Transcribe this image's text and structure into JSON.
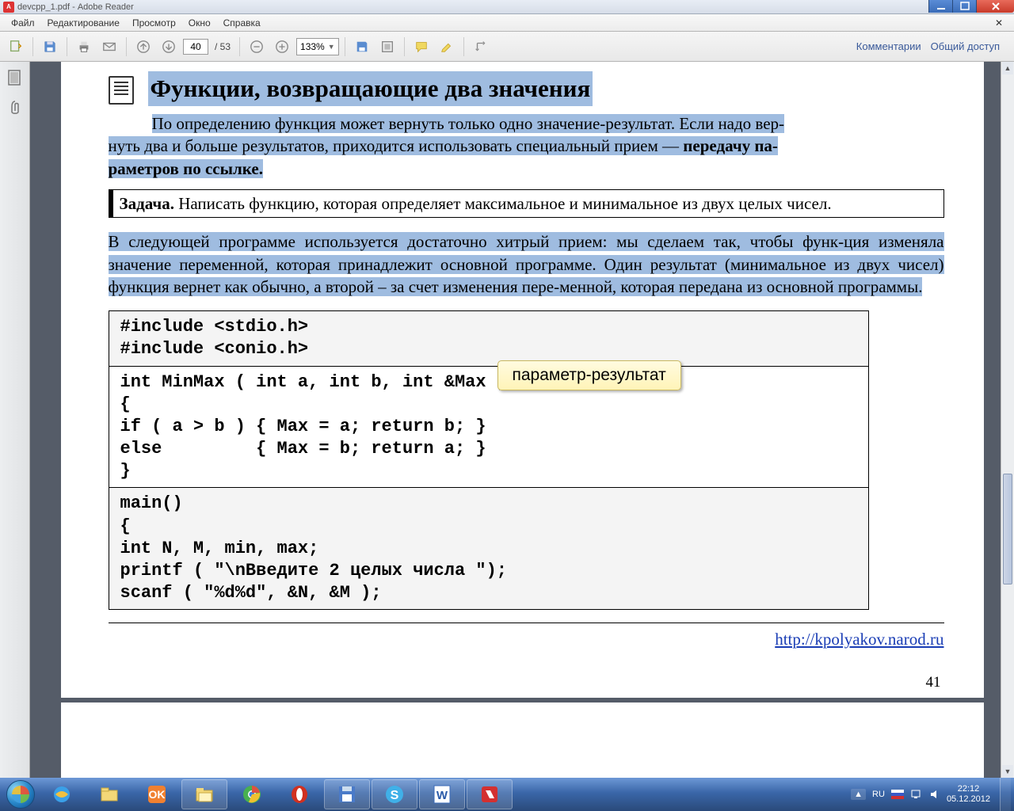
{
  "titlebar": {
    "filename": "devcpp_1.pdf",
    "app": "Adobe Reader"
  },
  "menu": {
    "file": "Файл",
    "edit": "Редактирование",
    "view": "Просмотр",
    "window": "Окно",
    "help": "Справка"
  },
  "toolbar": {
    "page_current": "40",
    "page_total": "/ 53",
    "zoom": "133%",
    "comments": "Комментарии",
    "share": "Общий доступ"
  },
  "content": {
    "heading": "Функции, возвращающие два значения",
    "p1a": "По определению функция может вернуть только одно значение-результат. Если надо вер-",
    "p1b": "нуть два и больше результатов, приходится использовать специальный прием — ",
    "p1c_bold": "передачу па-",
    "p1d_bold": "раметров по ссылке.",
    "task_label": "Задача.",
    "task_text": " Написать функцию, которая определяет максимальное и минимальное из двух целых чисел.",
    "p2": "В следующей программе используется достаточно хитрый прием: мы сделаем так, чтобы функ-ция изменяла значение переменной, которая принадлежит основной программе. Один результат (минимальное из двух чисел) функция вернет как обычно, а второй – за счет изменения пере-менной, которая передана из основной программы.",
    "callout": "параметр-результат",
    "code_includes": "#include <stdio.h>\n#include <conio.h>",
    "code_func": "int MinMax ( int a, int b, int &Max )\n{\nif ( a > b ) { Max = a; return b; }\nelse         { Max = b; return a; }\n}",
    "code_main": "main()\n{\nint N, M, min, max;\nprintf ( \"\\nВведите 2 целых числа \");\nscanf ( \"%d%d\", &N, &M );",
    "footer_url": "http://kpolyakov.narod.ru",
    "page_number": "41"
  },
  "tray": {
    "lang": "RU",
    "time": "22:12",
    "date": "05.12.2012"
  }
}
